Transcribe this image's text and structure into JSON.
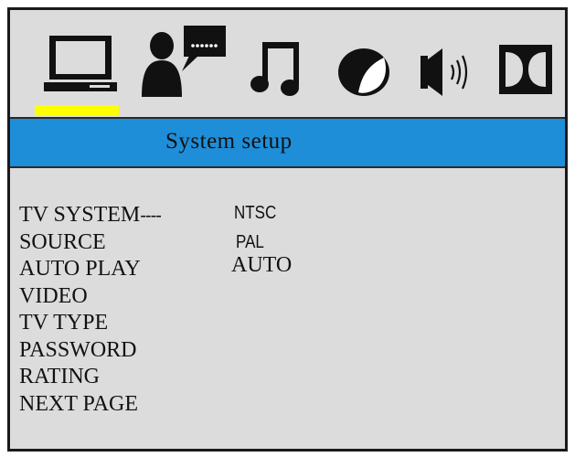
{
  "colors": {
    "frame_bg": "#dcdcdc",
    "title_bar": "#1f8ed8",
    "selector": "#ffff00",
    "text": "#111111"
  },
  "icons": [
    {
      "name": "monitor-icon",
      "selected": true
    },
    {
      "name": "language-speech-icon",
      "selected": false
    },
    {
      "name": "music-note-icon",
      "selected": false
    },
    {
      "name": "contrast-circle-icon",
      "selected": false
    },
    {
      "name": "speaker-volume-icon",
      "selected": false
    },
    {
      "name": "dolby-icon",
      "selected": false
    }
  ],
  "header": {
    "title": "System setup"
  },
  "menu": {
    "items": [
      {
        "label": "TV SYSTEM",
        "suffix": "----"
      },
      {
        "label": "SOURCE"
      },
      {
        "label": "AUTO PLAY"
      },
      {
        "label": "VIDEO"
      },
      {
        "label": "TV TYPE"
      },
      {
        "label": "PASSWORD"
      },
      {
        "label": "RATING"
      },
      {
        "label": "NEXT PAGE"
      }
    ]
  },
  "options": {
    "ntsc": "NTSC",
    "pal": "PAL",
    "auto": "AUTO"
  }
}
